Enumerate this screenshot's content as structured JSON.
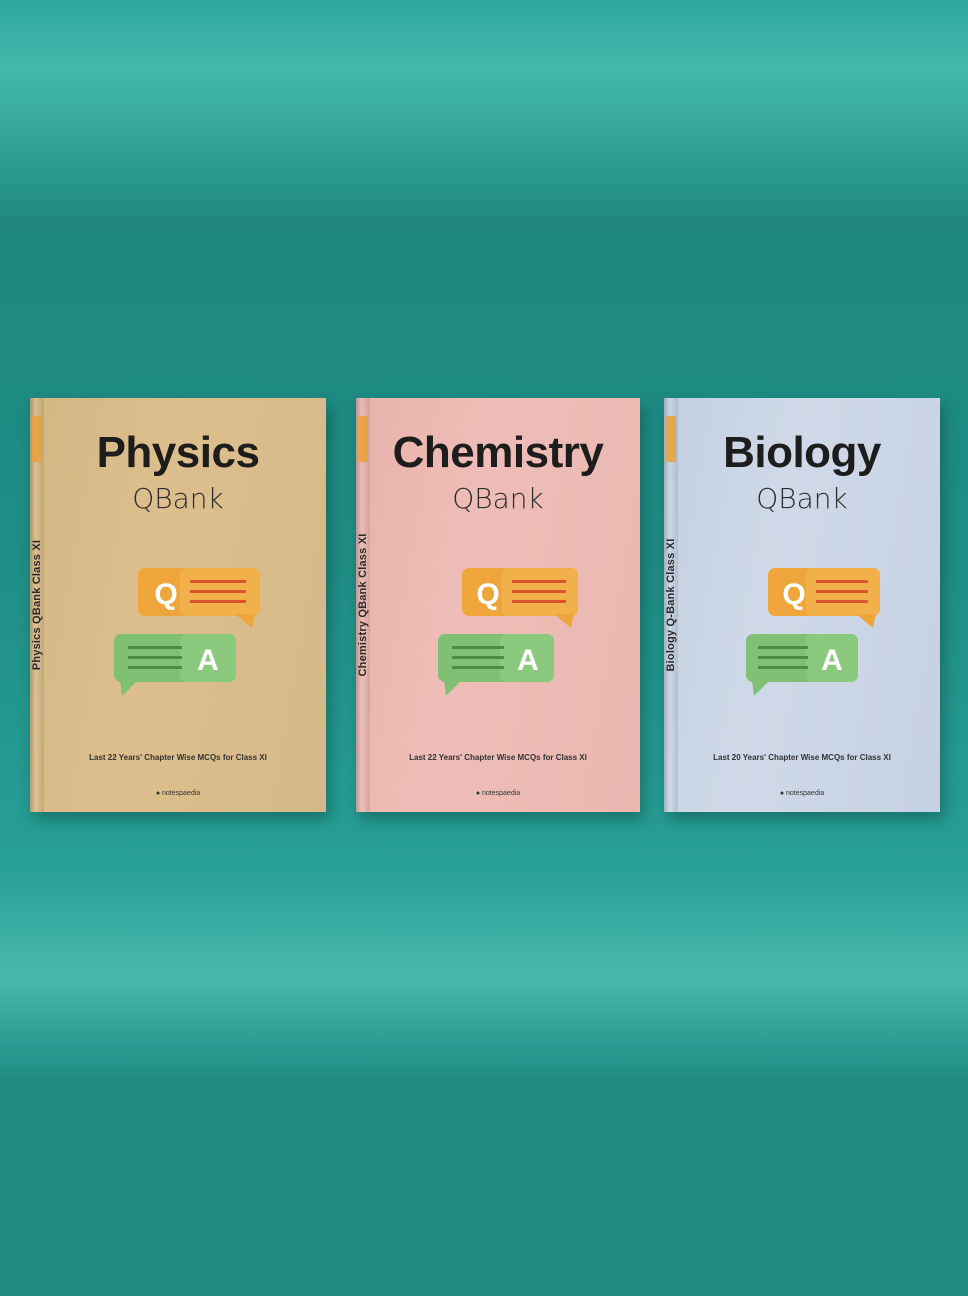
{
  "colors": {
    "background": "#1f8c85",
    "physics_cover": "#d9bb8a",
    "chemistry_cover": "#ecb8b2",
    "biology_cover": "#c8d3e4",
    "question_bubble": "#eea63c",
    "answer_bubble": "#7fc074"
  },
  "icons": [
    "question-bubble-icon",
    "answer-bubble-icon",
    "publisher-logo-icon"
  ],
  "books": [
    {
      "title": "Physics",
      "subtitle": "QBank",
      "q_letter": "Q",
      "a_letter": "A",
      "tagline": "Last 22 Years' Chapter Wise MCQs for Class XI",
      "spine": "Physics QBank Class XI",
      "publisher": "notespaedia"
    },
    {
      "title": "Chemistry",
      "subtitle": "QBank",
      "q_letter": "Q",
      "a_letter": "A",
      "tagline": "Last 22 Years' Chapter Wise MCQs for Class XI",
      "spine": "Chemistry QBank Class XI",
      "publisher": "notespaedia"
    },
    {
      "title": "Biology",
      "subtitle": "QBank",
      "q_letter": "Q",
      "a_letter": "A",
      "tagline": "Last 20 Years' Chapter Wise MCQs for Class XI",
      "spine": "Biology Q-Bank Class XI",
      "publisher": "notespaedia"
    }
  ]
}
